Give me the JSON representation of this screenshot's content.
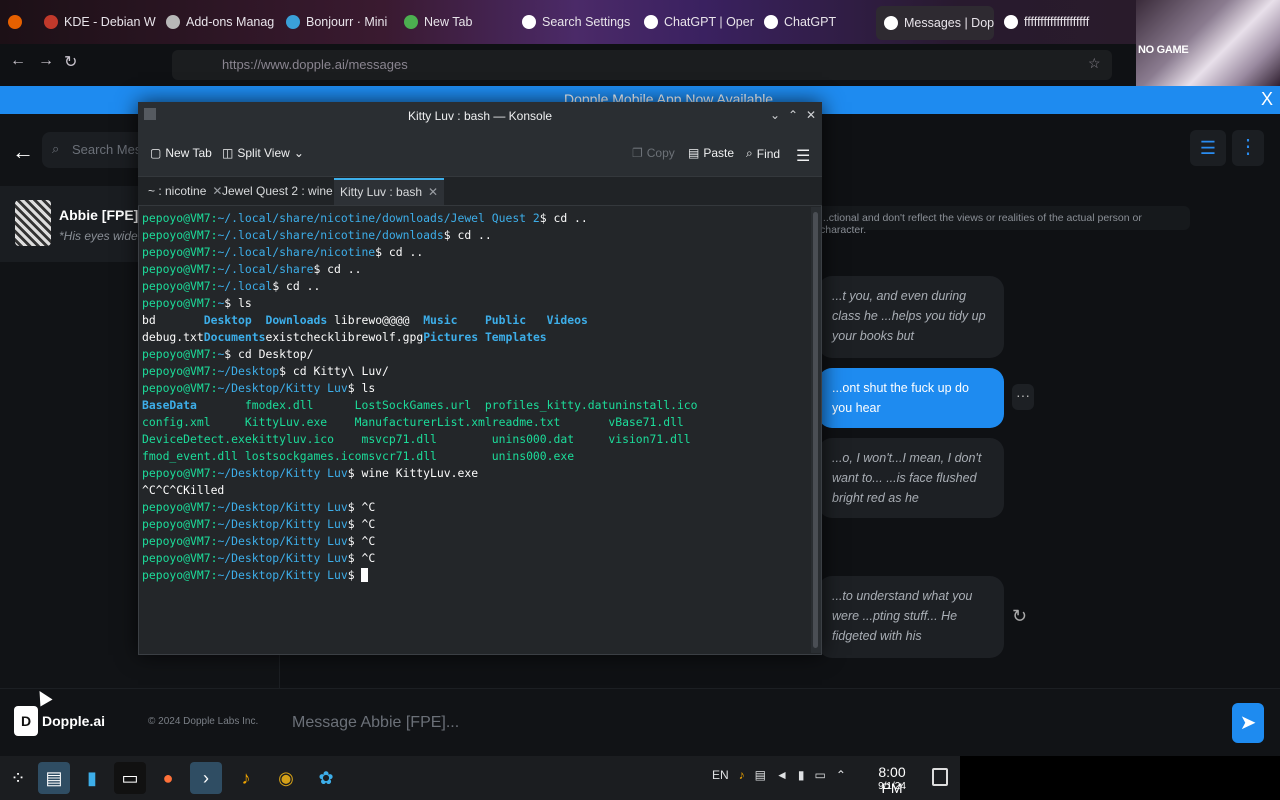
{
  "browser": {
    "tabs": [
      {
        "label": "KDE - Debian W",
        "color": "#c0392b"
      },
      {
        "label": "Add-ons Manag",
        "color": "#b8b8b8"
      },
      {
        "label": "Bonjourr · Mini",
        "color": "#3aa0d8"
      },
      {
        "label": "New Tab",
        "color": "#4caf50"
      },
      {
        "label": "Search Settings",
        "color": "#ffffff"
      },
      {
        "label": "ChatGPT | Oper",
        "color": "#ffffff"
      },
      {
        "label": "ChatGPT",
        "color": "#ffffff"
      },
      {
        "label": "Messages | Dop",
        "color": "#ffffff"
      },
      {
        "label": "ffffffffffffffffffff",
        "color": "#ffffff"
      }
    ],
    "url": "https://www.dopple.ai/messages",
    "anime_label": "NO GAME"
  },
  "banner": {
    "text": "Dopple Mobile App Now Available",
    "close": "X"
  },
  "sidebar": {
    "search_placeholder": "Search Messages",
    "chat_name": "Abbie [FPE]",
    "chat_preview": "*His eyes widened"
  },
  "main": {
    "disclaimer": "...ctional and don't reflect the views or realities of the actual person or character.",
    "messages": [
      {
        "role": "bot",
        "text": "...t you, and even during class he ...helps you tidy up your books but"
      },
      {
        "role": "user",
        "text": "...ont shut the fuck up do you hear"
      },
      {
        "role": "bot",
        "text": "...o, I won't...I mean, I don't want to... ...is face flushed bright red as he"
      },
      {
        "role": "bot",
        "text": "...to understand what you were ...pting stuff... He fidgeted with his"
      }
    ],
    "dots": "···"
  },
  "footer": {
    "logo_text": "Dopple.ai",
    "copyright": "© 2024 Dopple Labs Inc.",
    "message_placeholder": "Message Abbie [FPE]..."
  },
  "konsole": {
    "title": "Kitty Luv : bash — Konsole",
    "toolbar": {
      "new_tab": "New Tab",
      "split_view": "Split View",
      "copy": "Copy",
      "paste": "Paste",
      "find": "Find"
    },
    "tabs": [
      "~ : nicotine",
      "Jewel Quest 2 : wine",
      "Kitty Luv : bash"
    ],
    "lines": [
      {
        "user": "pepoyo@VM7",
        "path": "~/.local/share/nicotine/downloads/Jewel Quest 2",
        "cmd": "cd .."
      },
      {
        "user": "pepoyo@VM7",
        "path": "~/.local/share/nicotine/downloads",
        "cmd": "cd .."
      },
      {
        "user": "pepoyo@VM7",
        "path": "~/.local/share/nicotine",
        "cmd": "cd .."
      },
      {
        "user": "pepoyo@VM7",
        "path": "~/.local/share",
        "cmd": "cd .."
      },
      {
        "user": "pepoyo@VM7",
        "path": "~/.local",
        "cmd": "cd .."
      },
      {
        "user": "pepoyo@VM7",
        "path": "~",
        "cmd": "ls"
      }
    ],
    "ls_home": [
      [
        "bd",
        "Desktop",
        "Downloads",
        "librewo@@@@",
        "Music",
        "Public",
        "Videos"
      ],
      [
        "debug.txt",
        "Documents",
        "existcheck",
        "librewolf.gpg",
        "Pictures",
        "Templates",
        ""
      ]
    ],
    "lines2": [
      {
        "user": "pepoyo@VM7",
        "path": "~",
        "cmd": "cd Desktop/"
      },
      {
        "user": "pepoyo@VM7",
        "path": "~/Desktop",
        "cmd": "cd Kitty\\ Luv/"
      },
      {
        "user": "pepoyo@VM7",
        "path": "~/Desktop/Kitty Luv",
        "cmd": "ls"
      }
    ],
    "ls_kitty": [
      [
        "BaseData",
        "fmodex.dll",
        "LostSockGames.url",
        "profiles_kitty.dat",
        "uninstall.ico"
      ],
      [
        "config.xml",
        "KittyLuv.exe",
        "ManufacturerList.xml",
        "readme.txt",
        "vBase71.dll"
      ],
      [
        "DeviceDetect.exe",
        "kittyluv.ico",
        "msvcp71.dll",
        "unins000.dat",
        "vision71.dll"
      ],
      [
        "fmod_event.dll",
        "lostsockgames.ico",
        "msvcr71.dll",
        "unins000.exe",
        ""
      ]
    ],
    "wine_cmd": "wine KittyLuv.exe",
    "killed": "^C^C^CKilled",
    "tail": [
      "^C",
      "^C",
      "^C",
      "^C"
    ],
    "final_path": "~/Desktop/Kitty Luv"
  },
  "taskbar": {
    "lang": "EN",
    "time": "8:00 PM",
    "date": "9/1/24"
  }
}
